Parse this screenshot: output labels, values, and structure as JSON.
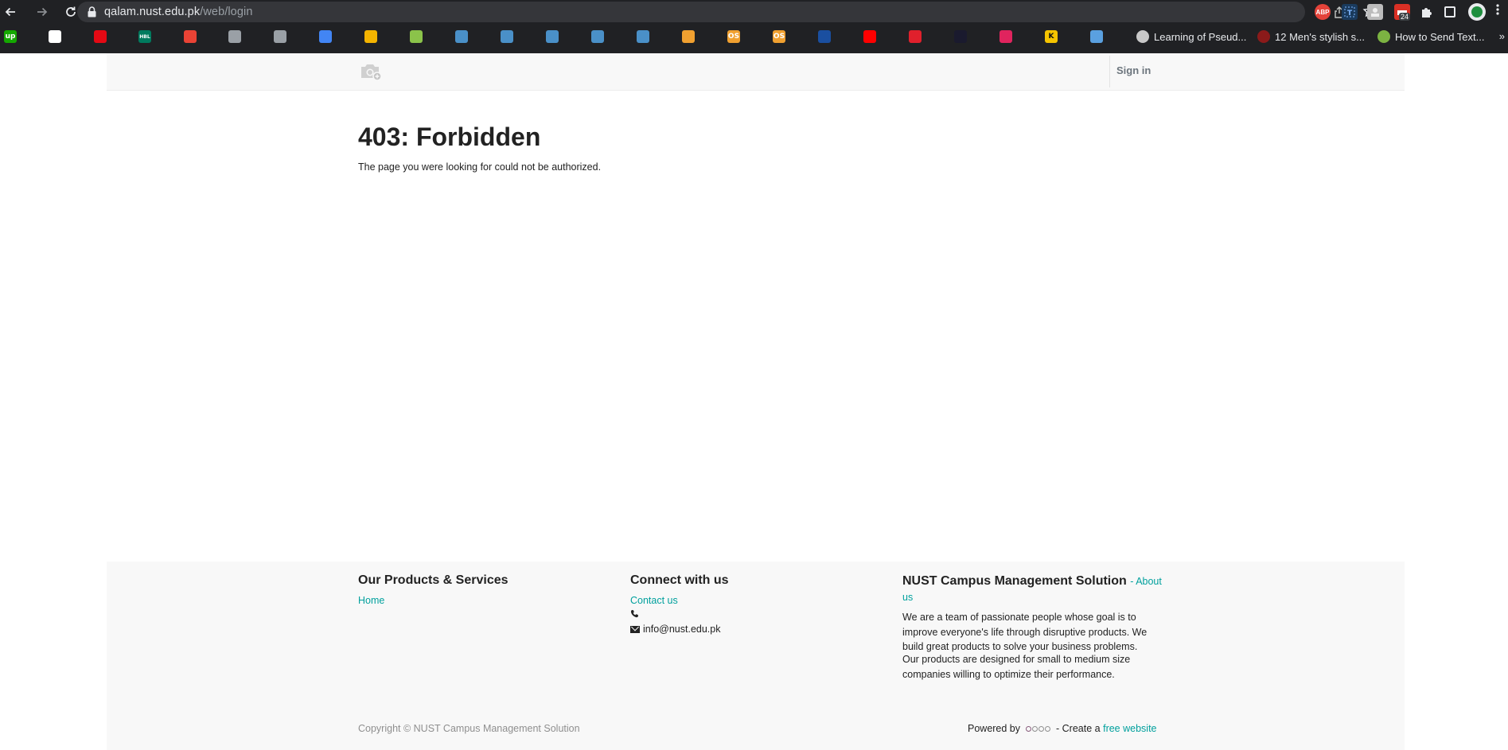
{
  "browser": {
    "url_host": "qalam.nust.edu.pk",
    "url_path": "/web/login",
    "extension_abp_label": "ABP",
    "calendar_badge": "24",
    "bookmarks": [
      {
        "icon": "upwork-icon",
        "color": "#14a800",
        "text": "up"
      },
      {
        "icon": "slash-icon",
        "color": "#ffffff"
      },
      {
        "icon": "netflix-icon",
        "color": "#e50914"
      },
      {
        "icon": "hbl-icon",
        "color": "#007a5e",
        "text": "HBL"
      },
      {
        "icon": "gmail-icon",
        "color": "#ea4335"
      },
      {
        "icon": "frame-icon",
        "color": "#9aa0a6"
      },
      {
        "icon": "globe-icon",
        "color": "#9aa0a6"
      },
      {
        "icon": "google-icon",
        "color": "#4285f4"
      },
      {
        "icon": "photo-icon",
        "color": "#f4b400"
      },
      {
        "icon": "leaf-icon",
        "color": "#8bc34a"
      },
      {
        "icon": "bank-icon-1",
        "color": "#4a90c8"
      },
      {
        "icon": "bank-icon-2",
        "color": "#4a90c8"
      },
      {
        "icon": "bank-icon-3",
        "color": "#4a90c8"
      },
      {
        "icon": "bank-icon-4",
        "color": "#4a90c8"
      },
      {
        "icon": "bank-icon-5",
        "color": "#4a90c8"
      },
      {
        "icon": "os-icon-1",
        "color": "#f0a030"
      },
      {
        "icon": "os-icon-2",
        "color": "#f0a030",
        "text": "OS"
      },
      {
        "icon": "os-icon-3",
        "color": "#f0a030",
        "text": "OS"
      },
      {
        "icon": "nust-icon",
        "color": "#1a4fa0"
      },
      {
        "icon": "youtube-icon",
        "color": "#ff0000"
      },
      {
        "icon": "question-icon",
        "color": "#e0202c"
      },
      {
        "icon": "lambda-icon",
        "color": "#1a1a2e"
      },
      {
        "icon": "camera-red-icon",
        "color": "#e0245e"
      },
      {
        "icon": "k-icon",
        "color": "#f5c400",
        "text": "K"
      },
      {
        "icon": "tile-icon",
        "color": "#5aa0e0"
      }
    ],
    "bookmark_labels": [
      {
        "icon": "pseudo-icon",
        "text": "Learning of Pseud..."
      },
      {
        "icon": "stylish-icon",
        "text": "12 Men's stylish s..."
      },
      {
        "icon": "leaf-green-icon",
        "text": "How to Send Text..."
      }
    ],
    "more_bookmarks": "»"
  },
  "header": {
    "signin_label": "Sign in"
  },
  "error": {
    "title": "403: Forbidden",
    "message": "The page you were looking for could not be authorized."
  },
  "footer": {
    "products_title": "Our Products & Services",
    "home_link": "Home",
    "connect_title": "Connect with us",
    "contact_link": "Contact us",
    "email": "info@nust.edu.pk",
    "about_title": "NUST Campus Management Solution",
    "about_link": "- About us",
    "about_text1": "We are a team of passionate people whose goal is to improve everyone's life through disruptive products. We build great products to solve your business problems.",
    "about_text2": "Our products are designed for small to medium size companies willing to optimize their performance.",
    "copyright": "Copyright © NUST Campus Management Solution",
    "powered_by": "Powered by",
    "create_text": "- Create a",
    "free_website_link": "free website"
  },
  "colors": {
    "accent": "#00a09d",
    "header_bg": "#f8f8f8",
    "chrome_bg": "#202124"
  }
}
